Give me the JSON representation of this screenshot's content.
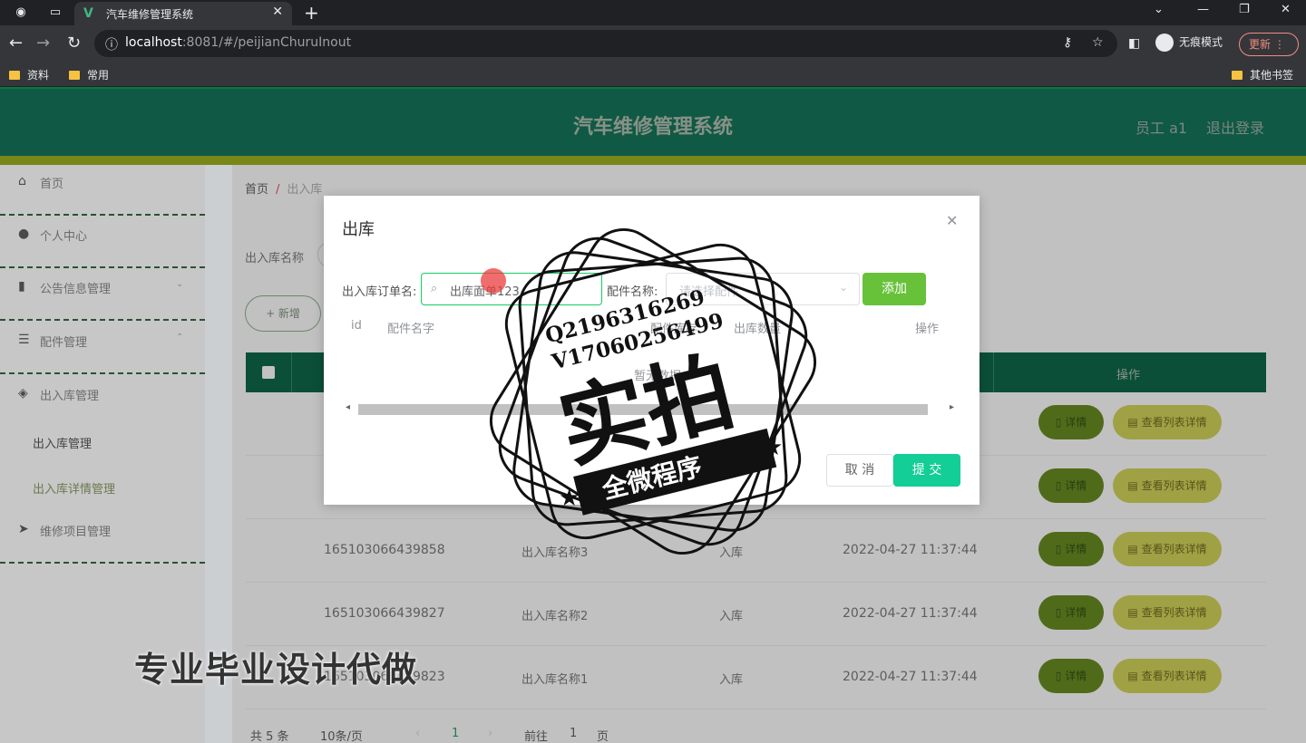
{
  "browser": {
    "tab_title": "汽车维修管理系统",
    "url_host": "localhost",
    "url_port": ":8081",
    "url_path": "/#/peijianChuruInout",
    "incognito_label": "无痕模式",
    "update_label": "更新",
    "bookmarks": [
      "资料",
      "常用"
    ],
    "other_bookmarks": "其他书签"
  },
  "header": {
    "title": "汽车维修管理系统",
    "user": "员工 a1",
    "logout": "退出登录"
  },
  "sidebar": {
    "items": [
      {
        "label": "首页",
        "icon": "home-icon"
      },
      {
        "label": "个人中心",
        "icon": "user-icon"
      },
      {
        "label": "公告信息管理",
        "icon": "chart-icon"
      },
      {
        "label": "配件管理",
        "icon": "sliders-icon"
      },
      {
        "label": "出入库管理",
        "icon": "shield-icon"
      },
      {
        "label": "维修项目管理",
        "icon": "send-icon"
      }
    ],
    "subitems": [
      "出入库管理",
      "出入库详情管理"
    ]
  },
  "main": {
    "breadcrumb_home": "首页",
    "breadcrumb_sep": "/",
    "breadcrumb_current": "出入库",
    "filter_label": "出入库名称",
    "add_button": "+ 新增",
    "table_header_op": "操作",
    "rows": [
      {
        "id": "",
        "name": "",
        "type": "",
        "time": ""
      },
      {
        "id": "",
        "name": "",
        "type": "",
        "time": ""
      },
      {
        "id": "165103066439858",
        "name": "出入库名称3",
        "type": "入库",
        "time": "2022-04-27 11:37:44"
      },
      {
        "id": "165103066439827",
        "name": "出入库名称2",
        "type": "入库",
        "time": "2022-04-27 11:37:44"
      },
      {
        "id": "165103066439823",
        "name": "出入库名称1",
        "type": "入库",
        "time": "2022-04-27 11:37:44"
      }
    ],
    "detail_label": "详情",
    "list_detail_label": "查看列表详情",
    "pagination": {
      "total": "共 5 条",
      "page_size": "10条/页",
      "current": "1",
      "goto_prefix": "前往",
      "goto_value": "1",
      "goto_suffix": "页"
    }
  },
  "dialog": {
    "title": "出库",
    "order_label": "出入库订单名:",
    "order_value": "出库面单123",
    "part_label": "配件名称:",
    "part_placeholder": "请选择配件",
    "add_button": "添加",
    "columns": [
      "id",
      "配件名字",
      "配件库存",
      "出库数量",
      "操作"
    ],
    "empty_text": "暂无数据",
    "cancel": "取 消",
    "submit": "提 交"
  },
  "watermark": {
    "qq": "Q2196316269",
    "vx": "V17060256499",
    "big": "实拍",
    "ribbon": "全微程序"
  },
  "promo_text": "专业毕业设计代做"
}
